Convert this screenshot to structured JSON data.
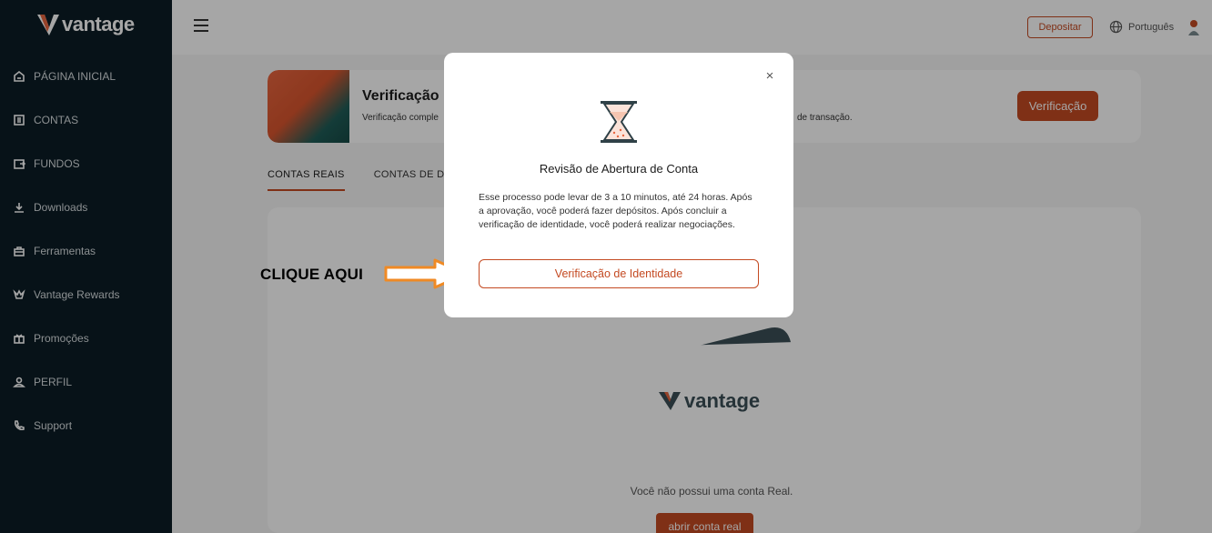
{
  "sidebar": {
    "logo_text": "vantage",
    "items": [
      {
        "label": "PÁGINA INICIAL",
        "icon": "home-icon"
      },
      {
        "label": "CONTAS",
        "icon": "accounts-icon"
      },
      {
        "label": "FUNDOS",
        "icon": "funds-icon"
      },
      {
        "label": "Downloads",
        "icon": "download-icon"
      },
      {
        "label": "Ferramentas",
        "icon": "tools-icon"
      },
      {
        "label": "Vantage Rewards",
        "icon": "crown-icon"
      },
      {
        "label": "Promoções",
        "icon": "gift-icon"
      },
      {
        "label": "PERFIL",
        "icon": "user-icon"
      },
      {
        "label": "Support",
        "icon": "phone-icon"
      }
    ]
  },
  "topbar": {
    "deposit_label": "Depositar",
    "language": "Português"
  },
  "banner": {
    "title": "Verificação",
    "subtitle_left": "Verificação comple",
    "subtitle_right": "de transação.",
    "button_label": "Verificação"
  },
  "tabs": [
    {
      "label": "CONTAS REAIS",
      "active": true
    },
    {
      "label": "CONTAS DE DE",
      "active": false
    }
  ],
  "empty_state": {
    "card_logo_text": "vantage",
    "message": "Você não possui uma conta Real.",
    "button_label": "abrir conta real"
  },
  "annotation": {
    "label": "CLIQUE AQUI",
    "arrow_color": "#f08a24"
  },
  "modal": {
    "close_symbol": "×",
    "title": "Revisão de Abertura de Conta",
    "body": "Esse processo pode levar de 3 a 10 minutos, até 24 horas. Após a aprovação, você poderá fazer depósitos. Após concluir a verificação de identidade, você poderá realizar negociações.",
    "button_label": "Verificação de Identidade"
  },
  "colors": {
    "brand": "#c44a22",
    "sidebar_bg": "#0c1d25"
  }
}
